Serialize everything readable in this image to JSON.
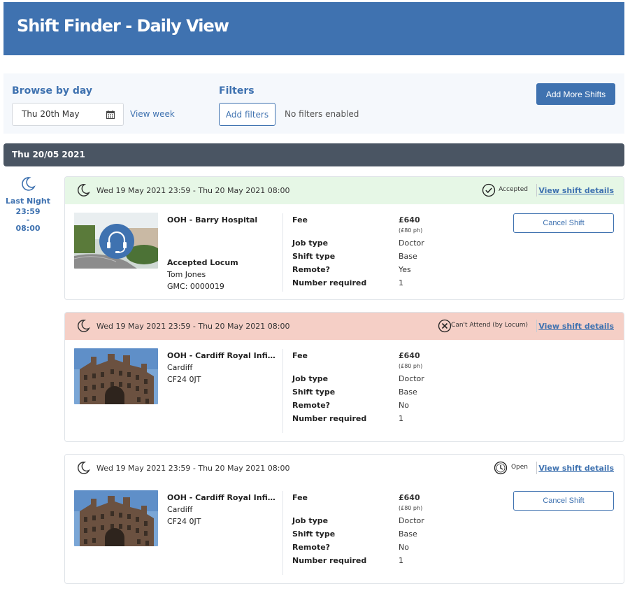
{
  "app": {
    "title": "Shift Finder - Daily View"
  },
  "filters": {
    "browse_label": "Browse by day",
    "date_value": "Thu 20th May",
    "view_week": "View week",
    "filters_label": "Filters",
    "add_filters": "Add filters",
    "no_filters": "No filters enabled",
    "add_more_shifts": "Add More Shifts"
  },
  "day": {
    "title": "Thu 20/05 2021",
    "side": {
      "label": "Last Night",
      "start": "23:59",
      "dash": "-",
      "end": "08:00"
    }
  },
  "labels": {
    "fee": "Fee",
    "job_type": "Job type",
    "shift_type": "Shift type",
    "remote": "Remote?",
    "number_required": "Number required",
    "view_details": "View shift details",
    "cancel": "Cancel Shift"
  },
  "shifts": [
    {
      "when": "Wed 19 May 2021 23:59 -  Thu 20 May 2021 08:00",
      "status": "Accepted",
      "status_icon": "check-circle-icon",
      "header_color": "#e6f7e6",
      "site_name": "OOH - Barry Hospital",
      "accepted_label": "Accepted Locum",
      "locum_name": "Tom Jones",
      "gmc": "GMC: 0000019",
      "fee": "£640",
      "per_hour": "(£80 ph)",
      "job_type": "Doctor",
      "shift_type": "Base",
      "remote": "Yes",
      "number_required": "1"
    },
    {
      "when": "Wed 19 May 2021 23:59 -  Thu 20 May 2021 08:00",
      "status": "Can't Attend (by Locum)",
      "status_icon": "x-circle-icon",
      "header_color": "#f5cfc6",
      "site_name": "OOH - Cardiff Royal Infirmary",
      "city": "Cardiff",
      "postcode": "CF24 0JT",
      "fee": "£640",
      "per_hour": "(£80 ph)",
      "job_type": "Doctor",
      "shift_type": "Base",
      "remote": "No",
      "number_required": "1"
    },
    {
      "when": "Wed 19 May 2021 23:59 -  Thu 20 May 2021 08:00",
      "status": "Open",
      "status_icon": "clock-icon",
      "header_color": "#ffffff",
      "site_name": "OOH - Cardiff Royal Infirmary",
      "city": "Cardiff",
      "postcode": "CF24 0JT",
      "fee": "£640",
      "per_hour": "(£80 ph)",
      "job_type": "Doctor",
      "shift_type": "Base",
      "remote": "No",
      "number_required": "1"
    }
  ]
}
